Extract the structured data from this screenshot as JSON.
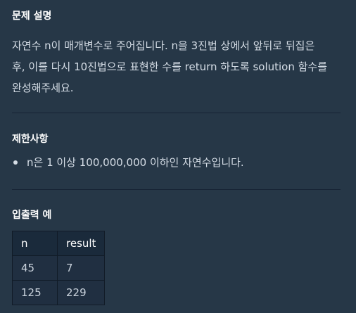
{
  "problem": {
    "title": "문제 설명",
    "description_lines": [
      "자연수 n이 매개변수로 주어집니다. n을 3진법 상에서 앞뒤로 뒤집은",
      "후, 이를 다시 10진법으로 표현한 수를 return 하도록 solution 함수를",
      "완성해주세요."
    ]
  },
  "constraints": {
    "title": "제한사항",
    "items": [
      "n은 1 이상 100,000,000 이하인 자연수입니다."
    ]
  },
  "examples": {
    "title": "입출력 예",
    "headers": [
      "n",
      "result"
    ],
    "rows": [
      [
        "45",
        "7"
      ],
      [
        "125",
        "229"
      ]
    ]
  },
  "colors": {
    "background": "#263747",
    "heading": "#ffffff",
    "text": "#d5dde6",
    "divider": "#172334",
    "table_header": "#1a2a3b",
    "table_cell": "#202f41"
  }
}
